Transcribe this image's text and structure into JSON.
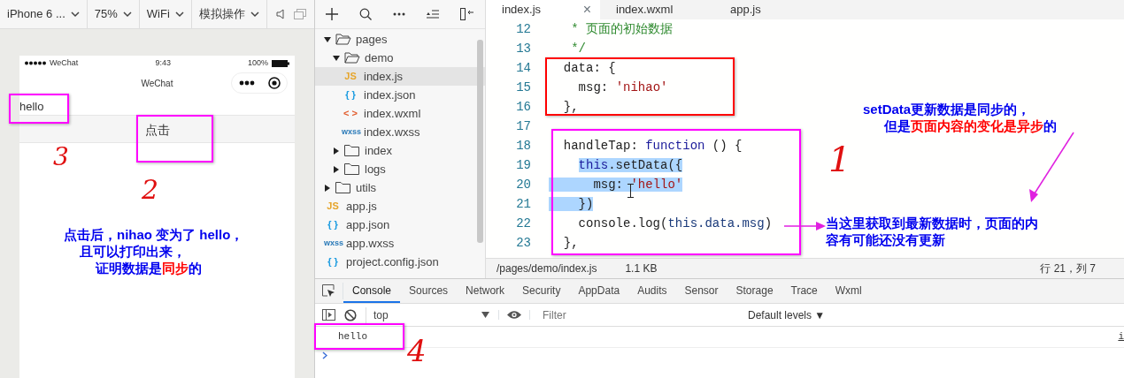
{
  "simulator_toolbar": {
    "items": [
      {
        "label": "iPhone 6 ..."
      },
      {
        "label": "75%"
      },
      {
        "label": "WiFi"
      },
      {
        "label": "模拟操作"
      }
    ]
  },
  "phone": {
    "carrier": "WeChat",
    "time": "9:43",
    "battery": "100%",
    "title": "WeChat",
    "message": "hello",
    "button": "点击"
  },
  "file_tree": {
    "items": [
      {
        "label": "pages",
        "kind": "folder",
        "expanded": true,
        "selected": false,
        "children": [
          {
            "label": "demo",
            "kind": "folder",
            "expanded": true,
            "selected": false,
            "children": [
              {
                "label": "index.js",
                "kind": "js",
                "icon": "JS",
                "selected": true
              },
              {
                "label": "index.json",
                "kind": "json",
                "icon": "{ }",
                "selected": false
              },
              {
                "label": "index.wxml",
                "kind": "wxml",
                "icon": "< >",
                "selected": false
              },
              {
                "label": "index.wxss",
                "kind": "wxss",
                "icon": "wxss",
                "selected": false
              }
            ]
          },
          {
            "label": "index",
            "kind": "folder",
            "expanded": false,
            "selected": false
          },
          {
            "label": "logs",
            "kind": "folder",
            "expanded": false,
            "selected": false
          }
        ]
      },
      {
        "label": "utils",
        "kind": "folder",
        "expanded": false,
        "selected": false
      },
      {
        "label": "app.js",
        "kind": "js",
        "icon": "JS",
        "selected": false
      },
      {
        "label": "app.json",
        "kind": "json",
        "icon": "{ }",
        "selected": false
      },
      {
        "label": "app.wxss",
        "kind": "wxss",
        "icon": "wxss",
        "selected": false
      },
      {
        "label": "project.config.json",
        "kind": "json",
        "icon": "{ }",
        "selected": false
      }
    ]
  },
  "editor": {
    "tabs": [
      {
        "label": "index.js",
        "selected": true,
        "close": "×"
      },
      {
        "label": "index.wxml",
        "selected": false
      },
      {
        "label": "app.js",
        "selected": false
      }
    ],
    "lines": [
      {
        "number": "12",
        "tokens": [
          {
            "t": "   * 页面的初始数据",
            "kind": "comment",
            "highlighted": false
          }
        ]
      },
      {
        "number": "13",
        "tokens": [
          {
            "t": "   */",
            "kind": "comment",
            "highlighted": false
          }
        ]
      },
      {
        "number": "14",
        "tokens": [
          {
            "t": "  data: {",
            "kind": "plain",
            "highlighted": false
          }
        ]
      },
      {
        "number": "15",
        "tokens": [
          {
            "t": "    msg: ",
            "kind": "plain",
            "highlighted": false
          },
          {
            "t": "'nihao'",
            "kind": "string",
            "highlighted": false
          }
        ]
      },
      {
        "number": "16",
        "tokens": [
          {
            "t": "  },",
            "kind": "plain",
            "highlighted": false
          }
        ]
      },
      {
        "number": "17"
      },
      {
        "number": "18",
        "tokens": [
          {
            "t": "  handleTap: ",
            "kind": "plain",
            "highlighted": false
          },
          {
            "t": "function",
            "kind": "keyword",
            "highlighted": false
          },
          {
            "t": " () {",
            "kind": "plain",
            "highlighted": false
          }
        ]
      },
      {
        "number": "19",
        "tokens": [
          {
            "t": "    this",
            "kind": "keyword",
            "highlighted": true
          },
          {
            "t": ".setData({",
            "kind": "plain",
            "highlighted": true
          }
        ]
      },
      {
        "number": "20",
        "tokens": [
          {
            "t": "      msg: ",
            "kind": "plain",
            "highlighted": true
          },
          {
            "t": "'hello'",
            "kind": "string",
            "highlighted": true
          }
        ]
      },
      {
        "number": "21",
        "tokens": [
          {
            "t": "    })",
            "kind": "plain",
            "highlighted": true
          }
        ]
      },
      {
        "number": "22",
        "tokens": [
          {
            "t": "    console.log(",
            "kind": "plain",
            "highlighted": false
          },
          {
            "t": "this.data.msg",
            "kind": "variable",
            "highlighted": false
          },
          {
            "t": ")",
            "kind": "plain",
            "highlighted": false
          }
        ]
      },
      {
        "number": "23",
        "tokens": [
          {
            "t": "  },",
            "kind": "plain",
            "highlighted": false
          }
        ]
      }
    ],
    "status": {
      "path": "/pages/demo/index.js",
      "size": "1.1 KB",
      "position": "行 21，列 7"
    }
  },
  "console": {
    "tabs": [
      {
        "label": "Console",
        "selected": true
      },
      {
        "label": "Sources",
        "selected": false
      },
      {
        "label": "Network",
        "selected": false
      },
      {
        "label": "Security",
        "selected": false
      },
      {
        "label": "AppData",
        "selected": false
      },
      {
        "label": "Audits",
        "selected": false
      },
      {
        "label": "Sensor",
        "selected": false
      },
      {
        "label": "Storage",
        "selected": false
      },
      {
        "label": "Trace",
        "selected": false
      },
      {
        "label": "Wxml",
        "selected": false
      }
    ],
    "context": "top",
    "filter": {
      "placeholder": "Filter"
    },
    "levels": "Default levels ▼",
    "logs": [
      {
        "text": "hello",
        "source": "i"
      }
    ]
  },
  "annotations": {
    "boxes": [
      {
        "color": "#ff00ff"
      },
      {
        "color": "#ff00ff"
      },
      {
        "color": "#ff0000"
      },
      {
        "color": "#ff00ff"
      },
      {
        "color": "#ff00ff"
      }
    ],
    "marks": [
      {
        "text": "3"
      },
      {
        "text": "2"
      },
      {
        "text": "1"
      },
      {
        "text": "4"
      }
    ],
    "notes": [
      {
        "lines": [
          [
            {
              "text": "点击后，nihao 变为了 hello，",
              "kind": "normal"
            }
          ],
          [
            {
              "text": "且可以打印出来，",
              "kind": "normal"
            }
          ],
          [
            {
              "text": "证明数据是",
              "kind": "normal"
            },
            {
              "text": "同步",
              "kind": "emphasis"
            },
            {
              "text": "的",
              "kind": "normal"
            }
          ]
        ]
      },
      {
        "lines": [
          [
            {
              "text": "setData更新数据是同步的，",
              "kind": "normal"
            }
          ],
          [
            {
              "text": "但是",
              "kind": "normal"
            },
            {
              "text": "页面内容的变化是异步",
              "kind": "emphasis"
            },
            {
              "text": "的",
              "kind": "normal"
            }
          ]
        ]
      },
      {
        "lines": [
          [
            {
              "text": "当这里获取到最新数据时，页面的内",
              "kind": "normal"
            }
          ],
          [
            {
              "text": "容有可能还没有更新",
              "kind": "normal"
            }
          ]
        ]
      }
    ]
  }
}
